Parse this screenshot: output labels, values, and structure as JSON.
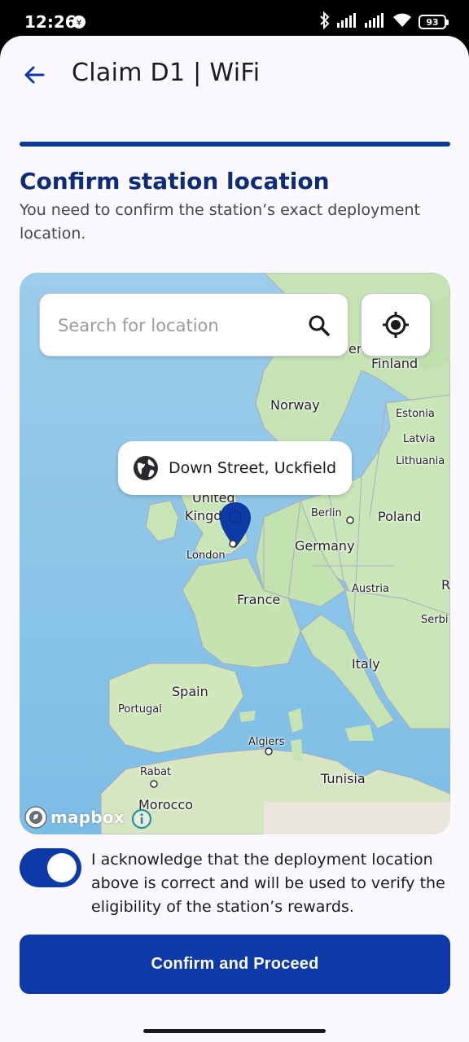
{
  "status_bar": {
    "time": "12:26",
    "battery": "93"
  },
  "header": {
    "title": "Claim D1 | WiFi",
    "back_icon": "arrow-left-icon"
  },
  "progress": {
    "fraction": 1.0
  },
  "content": {
    "heading": "Confirm station location",
    "subtitle": "You need to confirm the station’s exact deployment location."
  },
  "map": {
    "search_placeholder": "Search for location",
    "address": "Down Street, Uckfield",
    "attribution": "mapbox",
    "labels": {
      "finland": "Finland",
      "norway": "Norway",
      "estonia": "Estonia",
      "latvia": "Latvia",
      "lithuania": "Lithuania",
      "united_kingdom_1": "United",
      "united_kingdom_2": "Kingdom",
      "berlin": "Berlin",
      "poland": "Poland",
      "london": "London",
      "germany": "Germany",
      "austria": "Austria",
      "r_edge": "R",
      "france": "France",
      "serbia": "Serbi",
      "italy": "Italy",
      "spain": "Spain",
      "portugal": "Portugal",
      "algiers": "Algiers",
      "rabat": "Rabat",
      "tunisia": "Tunisia",
      "morocco": "Morocco",
      "er_fragment": "er"
    }
  },
  "acknowledge": {
    "enabled": true,
    "text": "I acknowledge that the deployment location above is correct and will be used to verify the eligibility of the station’s rewards."
  },
  "actions": {
    "confirm_label": "Confirm and Proceed"
  },
  "colors": {
    "primary": "#0d3aa6",
    "heading": "#0d2c78",
    "water": "#86c3e8",
    "land": "#bfe0b0"
  }
}
